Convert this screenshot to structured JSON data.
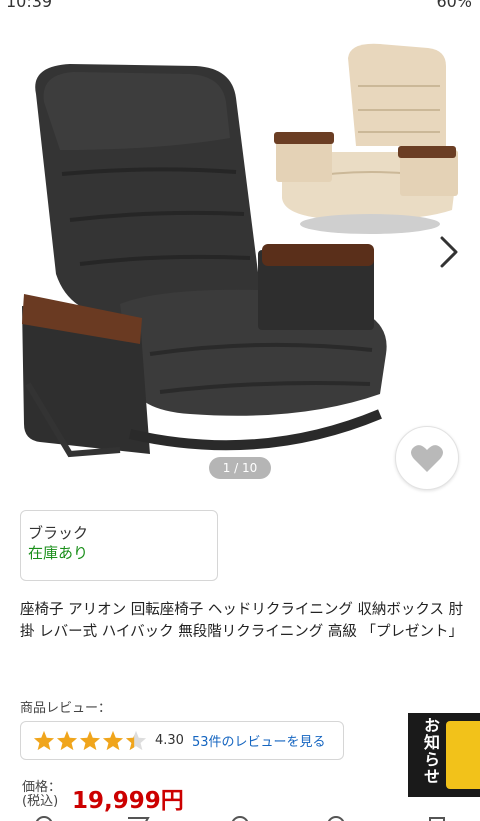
{
  "status_bar": {
    "time": "10:39",
    "battery": "60%"
  },
  "gallery": {
    "pager": "1 / 10",
    "images": [
      "black-chair-photo",
      "beige-chair-photo"
    ],
    "next_icon": "chevron-right-icon",
    "favorite_icon": "heart-icon"
  },
  "variant": {
    "name": "ブラック",
    "stock": "在庫あり"
  },
  "product": {
    "title": "座椅子 アリオン 回転座椅子 ヘッドリクライニング 収納ボックス 肘掛 レバー式 ハイバック 無段階リクライニング 高級 「プレゼント」"
  },
  "reviews": {
    "label": "商品レビュー：",
    "rating": "4.30",
    "rating_value": 4.3,
    "link": "53件のレビューを見る"
  },
  "notice": {
    "label": "お知らせ"
  },
  "price": {
    "label_line1": "価格：",
    "label_line2": "(税込)",
    "value": "19,999円"
  },
  "colors": {
    "price": "#cc0000",
    "stock": "#1a8f1a",
    "link": "#1565c0",
    "star": "#f0a51c"
  }
}
